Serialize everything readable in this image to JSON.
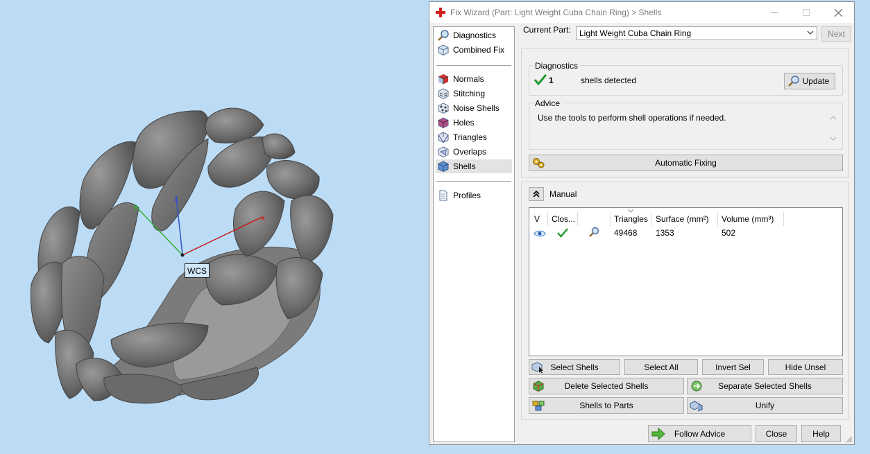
{
  "viewport": {
    "wcs_label": "WCS",
    "axes": {
      "x": "x",
      "y": "y",
      "z": "z"
    }
  },
  "window": {
    "title": "Fix Wizard (Part: Light Weight Cuba Chain Ring) > Shells"
  },
  "nav": {
    "items": [
      {
        "label": "Diagnostics",
        "icon": "magnifier-icon"
      },
      {
        "label": "Combined Fix",
        "icon": "cube-icon"
      },
      {
        "label": "Normals",
        "icon": "normals-icon"
      },
      {
        "label": "Stitching",
        "icon": "stitching-icon"
      },
      {
        "label": "Noise Shells",
        "icon": "noise-shells-icon"
      },
      {
        "label": "Holes",
        "icon": "holes-icon"
      },
      {
        "label": "Triangles",
        "icon": "triangles-icon"
      },
      {
        "label": "Overlaps",
        "icon": "overlaps-icon"
      },
      {
        "label": "Shells",
        "icon": "shells-icon"
      },
      {
        "label": "Profiles",
        "icon": "document-icon"
      }
    ],
    "selected": "Shells"
  },
  "current_part": {
    "label": "Current Part:",
    "value": "Light Weight Cuba Chain Ring",
    "next_button": "Next"
  },
  "diagnostics": {
    "title": "Diagnostics",
    "count": "1",
    "status_text": "shells detected",
    "update_button": "Update"
  },
  "advice": {
    "title": "Advice",
    "text": "Use the tools to perform shell operations if needed."
  },
  "automatic_fixing_button": "Automatic Fixing",
  "manual": {
    "title": "Manual",
    "columns": [
      "V",
      "Clos...",
      "",
      "Triangles",
      "Surface (mm²)",
      "Volume (mm³)"
    ],
    "rows": [
      {
        "visible": "eye-icon",
        "closed": "checkmark-icon",
        "tool": "magnifier-icon",
        "triangles": "49468",
        "surface": "1353",
        "volume": "502"
      }
    ]
  },
  "buttons": {
    "select_shells": "Select Shells",
    "select_all": "Select All",
    "invert_sel": "Invert Sel",
    "hide_unsel": "Hide Unsel",
    "delete_selected_shells": "Delete Selected Shells",
    "separate_selected_shells": "Separate Selected Shells",
    "shells_to_parts": "Shells to Parts",
    "unify": "Unify",
    "follow_advice": "Follow Advice",
    "close": "Close",
    "help": "Help"
  },
  "colors": {
    "viewport_bg": "#bcdcf6",
    "dialog_bg": "#f0f0f0",
    "check_green": "#1e9a2e",
    "axis_x": "#c81414",
    "axis_y": "#2fae2f",
    "axis_z": "#2a52c8"
  }
}
